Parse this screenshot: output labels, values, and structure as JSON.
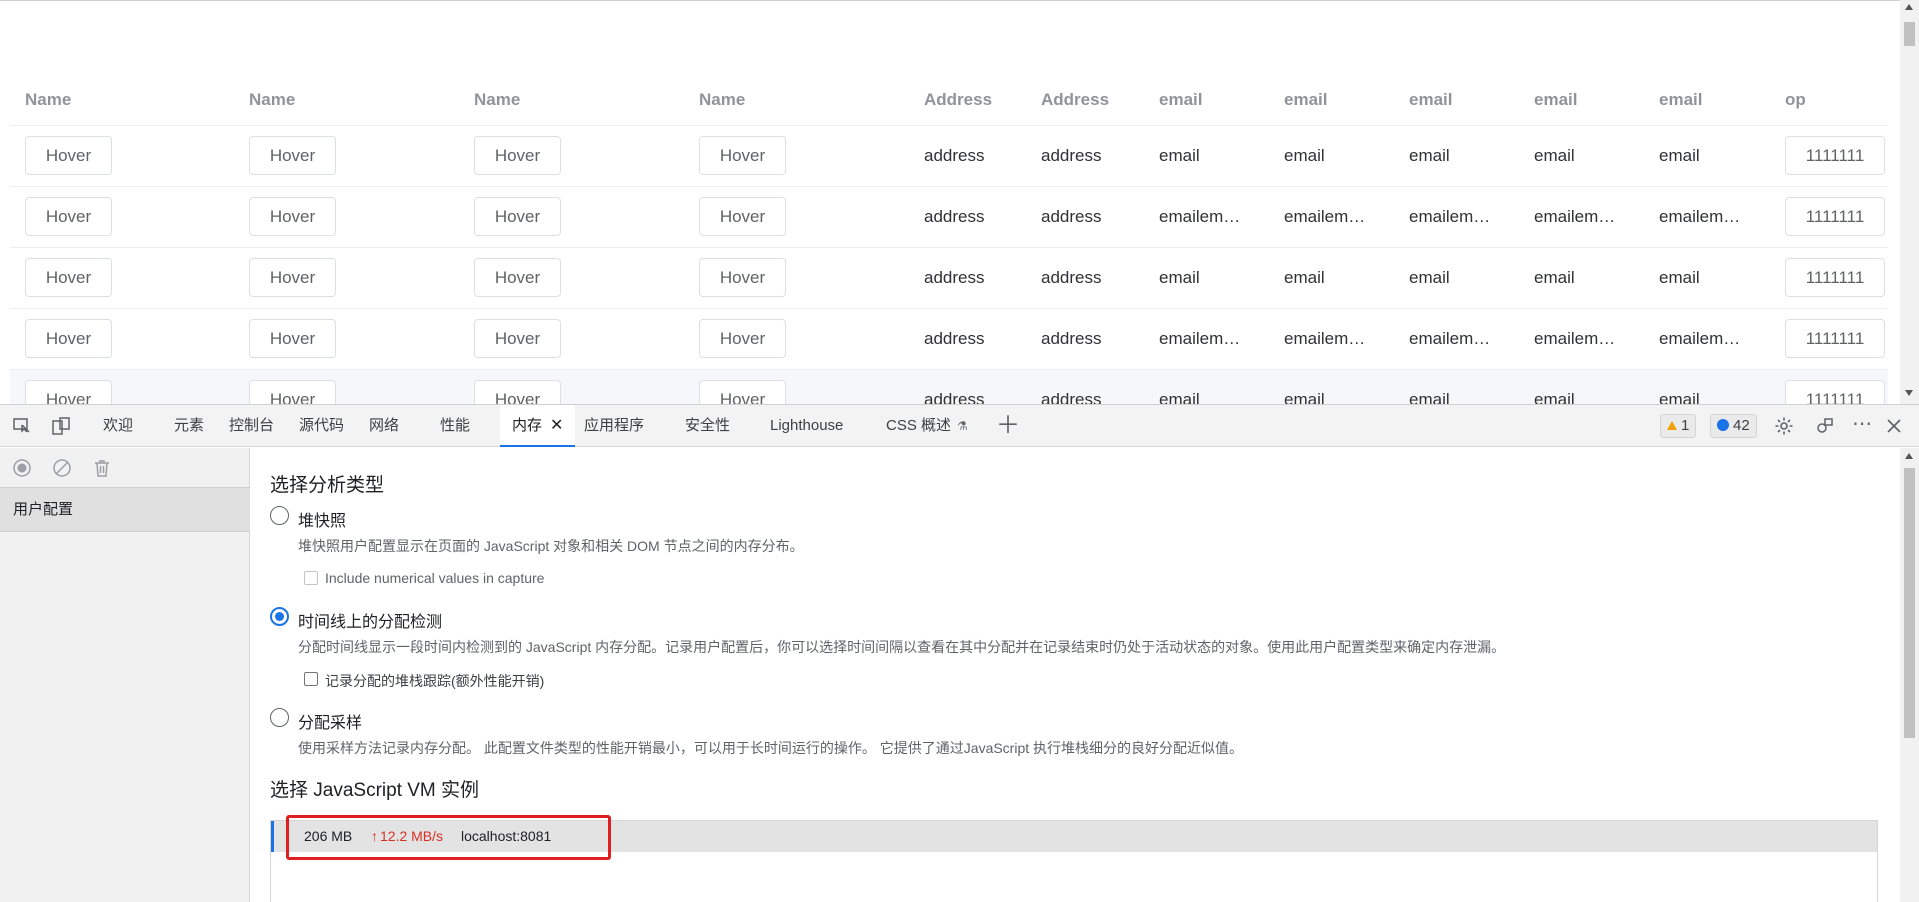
{
  "table": {
    "headers": [
      "Name",
      "Name",
      "Name",
      "Name",
      "Address",
      "Address",
      "email",
      "email",
      "email",
      "email",
      "email",
      "op"
    ],
    "rows": [
      {
        "btn": "Hover",
        "addr": "address",
        "email": "email",
        "op": "1111111"
      },
      {
        "btn": "Hover",
        "addr": "address",
        "email": "emailem…",
        "op": "1111111"
      },
      {
        "btn": "Hover",
        "addr": "address",
        "email": "email",
        "op": "1111111"
      },
      {
        "btn": "Hover",
        "addr": "address",
        "email": "emailem…",
        "op": "1111111"
      },
      {
        "btn": "Hover",
        "addr": "address",
        "email": "email",
        "op": "1111111"
      }
    ]
  },
  "devtools": {
    "tabs": [
      "欢迎",
      "元素",
      "控制台",
      "源代码",
      "网络",
      "性能",
      "内存",
      "应用程序",
      "安全性",
      "Lighthouse",
      "CSS 概述"
    ],
    "active_tab": "内存",
    "warning_count": "1",
    "message_count": "42",
    "sidebar_item": "用户配置",
    "section1_title": "选择分析类型",
    "option_heap": "堆快照",
    "option_heap_desc": "堆快照用户配置显示在页面的 JavaScript 对象和相关 DOM 节点之间的内存分布。",
    "option_heap_cb": "Include numerical values in capture",
    "option_timeline": "时间线上的分配检测",
    "option_timeline_desc": "分配时间线显示一段时间内检测到的 JavaScript 内存分配。记录用户配置后，你可以选择时间间隔以查看在其中分配并在记录结束时仍处于活动状态的对象。使用此用户配置类型来确定内存泄漏。",
    "option_timeline_cb": "记录分配的堆栈跟踪(额外性能开销)",
    "option_sampling": "分配采样",
    "option_sampling_desc": "使用采样方法记录内存分配。 此配置文件类型的性能开销最小，可以用于长时间运行的操作。 它提供了通过JavaScript 执行堆栈细分的良好分配近似值。",
    "section2_title": "选择 JavaScript VM 实例",
    "vm": {
      "size": "206 MB",
      "rate": "12.2 MB/s",
      "host": "localhost:8081"
    },
    "colors": {
      "accent": "#1a73e8",
      "rate": "#d93025",
      "highlight": "#e02020"
    }
  }
}
